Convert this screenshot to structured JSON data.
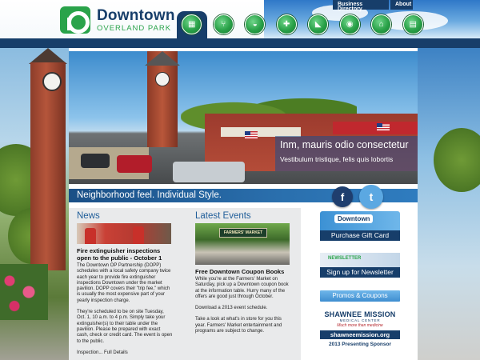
{
  "logo": {
    "title": "Downtown",
    "subtitle": "OVERLAND PARK"
  },
  "top_links": {
    "business_directory": "Business Directory",
    "about": "About"
  },
  "nav": [
    {
      "label": "EVENTS",
      "icon": "calendar-icon",
      "glyph": "▦"
    },
    {
      "label": "FOOD/DRINK",
      "icon": "fork-knife-icon",
      "glyph": "⑂"
    },
    {
      "label": "MARKET",
      "icon": "basket-icon",
      "glyph": "◒"
    },
    {
      "label": "SHOPS",
      "icon": "shirt-icon",
      "glyph": "✚"
    },
    {
      "label": "NEWS",
      "icon": "megaphone-icon",
      "glyph": "◣"
    },
    {
      "label": "MAP",
      "icon": "map-pin-icon",
      "glyph": "◉"
    },
    {
      "label": "LIVING",
      "icon": "house-icon",
      "glyph": "⌂"
    },
    {
      "label": "BIZ TOOLS",
      "icon": "briefcase-icon",
      "glyph": "▤"
    }
  ],
  "hero": {
    "title": "Inm, mauris odio consectetur",
    "subtitle": "Vestibulum tristique, felis quis lobortis"
  },
  "tagline": "Neighborhood feel. Individual Style.",
  "social": {
    "facebook": "f",
    "twitter": "t"
  },
  "news": {
    "heading": "News",
    "title": "Fire extinguisher inspections open to the public - October 1",
    "paragraphs": [
      "The Downtown OP Partnership (DOPP) schedules with a local safety company twice each year to provide fire extinguisher inspections Downtown under the market pavilion. DOPP covers their \"trip fee,\" which is usually the most expensive part of your yearly inspection charge.",
      "They're scheduled to be on site Tuesday, Oct. 1, 10 a.m. to 4 p.m. Simply take your extinguisher(s) to their table under the pavilion. Please be prepared with exact cash, check or credit card. The event is open to the public.",
      "Inspection... Full Details"
    ]
  },
  "events": {
    "heading": "Latest Events",
    "image_sign": "FARMERS' MARKET",
    "title": "Free Downtown Coupon Books",
    "paragraphs": [
      "While you're at the Farmers' Market on Saturday, pick up a Downtown coupon book at the information table. Hurry many of the offers are good just through October.",
      "Download a 2013 event schedule.",
      "Take a look at what's in store for you this year. Farmers' Market entertainment and programs are subject to change."
    ]
  },
  "sidebar": {
    "gift_card_image_text": "Downtown",
    "gift_card_button": "Purchase Gift Card",
    "newsletter_image_text": "NEWSLETTER",
    "newsletter_button": "Sign up for Newsletter",
    "promos_button": "Promos & Coupons",
    "sponsor": {
      "name": "SHAWNEE MISSION",
      "sub": "MEDICAL CENTER",
      "tag": "Much more than medicine",
      "url": "shawneemission.org",
      "label": "2013 Presenting Sponsor"
    }
  },
  "colors": {
    "navy": "#173e6a",
    "green": "#2aa34a",
    "blue": "#1f5d99"
  }
}
